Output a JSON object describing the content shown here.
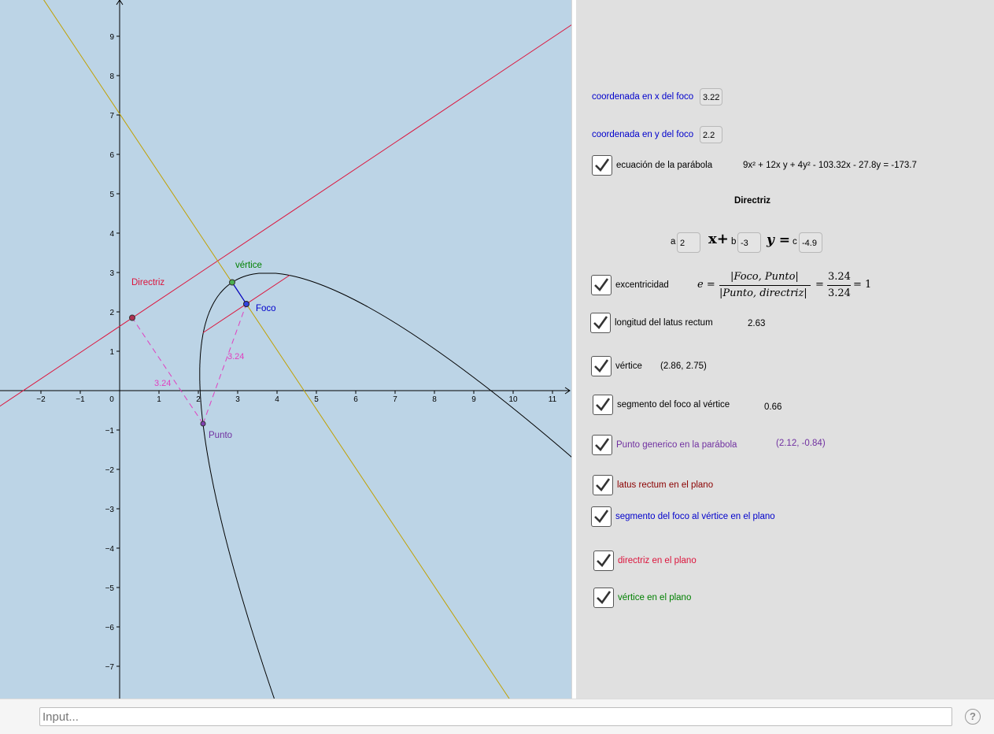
{
  "graphics": {
    "x_axis_ticks": [
      "−2",
      "−1",
      "0",
      "1",
      "2",
      "3",
      "4",
      "5",
      "6",
      "7",
      "8",
      "9",
      "10",
      "11"
    ],
    "y_axis_ticks": [
      "9",
      "8",
      "7",
      "6",
      "5",
      "4",
      "3",
      "2",
      "1",
      "−1",
      "−2",
      "−3",
      "−4",
      "−5",
      "−6",
      "−7"
    ],
    "labels": {
      "directriz": "Directriz",
      "vertice": "vértice",
      "foco": "Foco",
      "punto": "Punto",
      "dist_foco": "3.24",
      "dist_directriz": "3.24"
    },
    "colors": {
      "background": "#bcd4e6",
      "directrix": "#dc143c",
      "axis_line": "#c0a000",
      "parabola": "#000000",
      "dashed": "#e040c0",
      "focus": "#0000cc",
      "vertex": "#008000",
      "point": "#7030a0"
    }
  },
  "panel": {
    "focus_x_label": "coordenada en x del foco",
    "focus_x_value": "3.22",
    "focus_y_label": "coordenada en y del foco",
    "focus_y_value": "2.2",
    "ecuacion_label": "ecuación de la parábola",
    "ecuacion_value": "9x² + 12x y + 4y² - 103.32x - 27.8y = -173.7",
    "directriz_title": "Directriz",
    "dir_a_label": "a",
    "dir_a_value": "2",
    "dir_x_plus": "x+",
    "dir_b_label": "b",
    "dir_b_value": "-3",
    "dir_y_eq": "y =",
    "dir_c_label": "c",
    "dir_c_value": "-4.9",
    "excentricidad_label": "excentricidad",
    "exc_e": "e =",
    "exc_num": "|Foco, Punto|",
    "exc_den": "|Punto, directriz|",
    "exc_eq1": "=",
    "exc_num2": "3.24",
    "exc_den2": "3.24",
    "exc_eq2": "= 1",
    "latus_label": "longitud del latus rectum",
    "latus_value": "2.63",
    "vertice_label": "vértice",
    "vertice_value": "(2.86, 2.75)",
    "segmento_label": "segmento del foco al vértice",
    "segmento_value": "0.66",
    "punto_label": "Punto generico en la parábola",
    "punto_value": "(2.12, -0.84)",
    "latus_plano_label": "latus rectum en el plano",
    "segmento_plano_label": "segmento del foco al vértice en el plano",
    "directriz_plano_label": "directriz en el plano",
    "vertice_plano_label": "vértice en el plano"
  },
  "inputbar": {
    "placeholder": "Input...",
    "help": "?"
  }
}
